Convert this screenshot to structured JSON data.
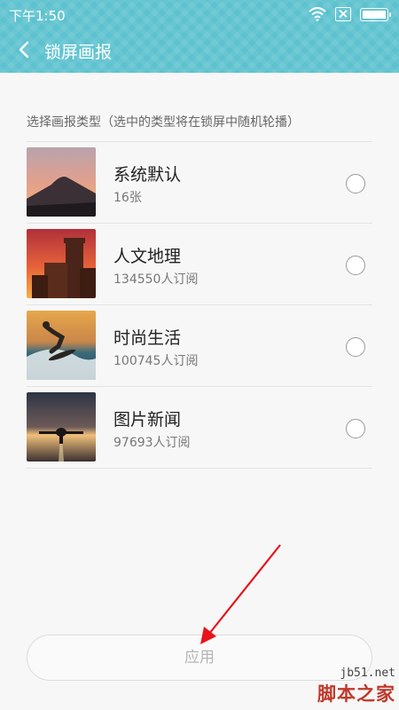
{
  "status_bar": {
    "time": "下午1:50",
    "battery_level": 1.0
  },
  "header": {
    "title": "锁屏画报",
    "back_icon": "chevron-left-icon"
  },
  "section_label": "选择画报类型（选中的类型将在锁屏中随机轮播）",
  "items": [
    {
      "name": "系统默认",
      "sub": "16张",
      "thumb": "mountain-sunset",
      "selected": false
    },
    {
      "name": "人文地理",
      "sub": "134550人订阅",
      "thumb": "castle-sunset",
      "selected": false
    },
    {
      "name": "时尚生活",
      "sub": "100745人订阅",
      "thumb": "surfer",
      "selected": false
    },
    {
      "name": "图片新闻",
      "sub": "97693人订阅",
      "thumb": "airplane-runway",
      "selected": false
    }
  ],
  "apply_button": {
    "label": "应用"
  },
  "watermark": {
    "url": "jb51.net",
    "name": "脚本之家"
  },
  "colors": {
    "header": "#5cc2cf",
    "arrow": "#e8141c",
    "watermark_red": "#c0392b"
  }
}
